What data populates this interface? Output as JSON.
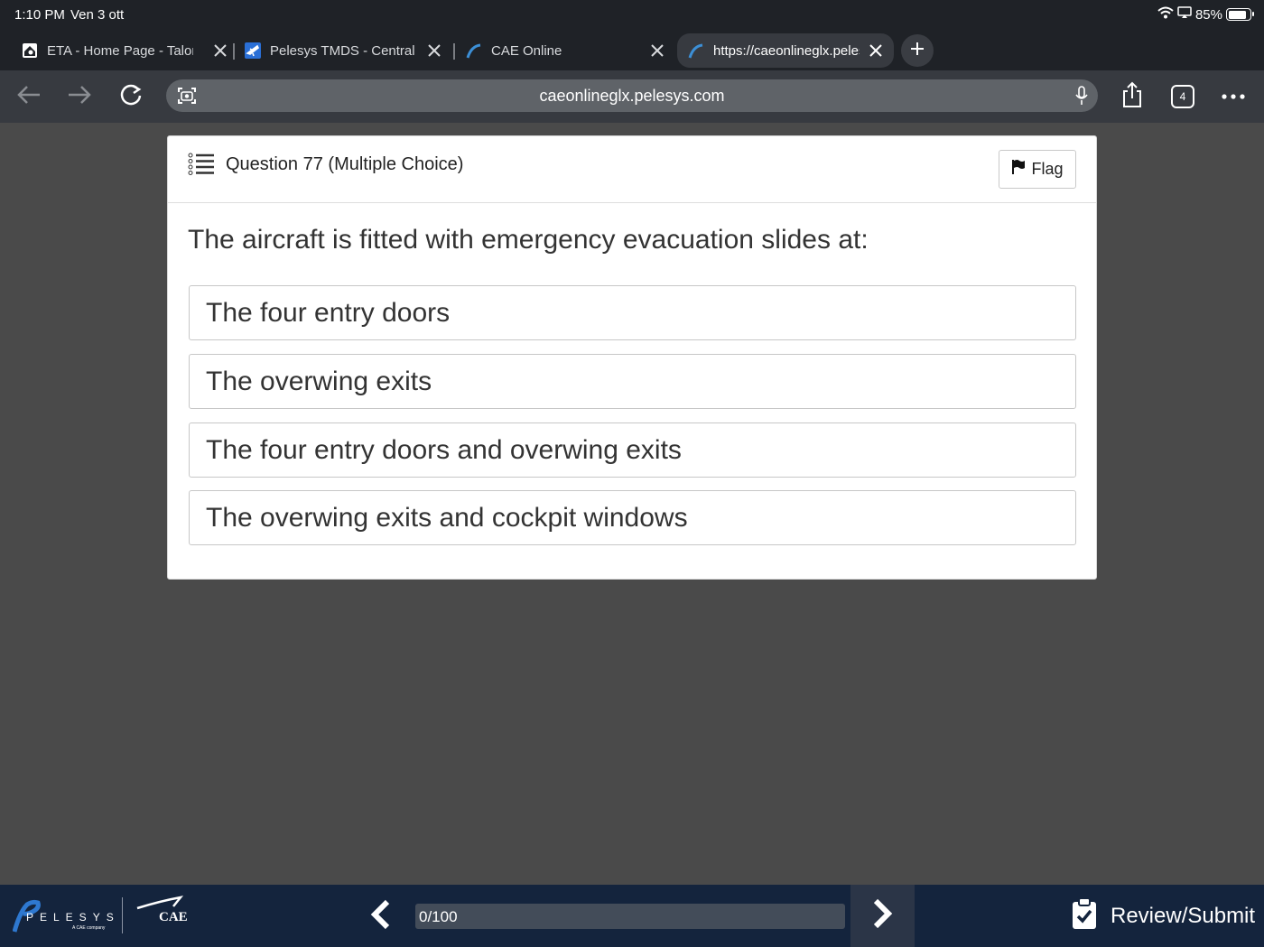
{
  "status": {
    "time": "1:10 PM",
    "date": "Ven 3 ott",
    "battery": "85%",
    "battery_level": 0.85
  },
  "tabs": [
    {
      "title": "ETA - Home Page - Talon",
      "icon": "home-icon"
    },
    {
      "title": "Pelesys TMDS - Central",
      "icon": "airplane-icon"
    },
    {
      "title": "CAE Online",
      "icon": "pelesys-icon"
    },
    {
      "title": "https://caeonlineglx.pelesys.com",
      "icon": "pelesys-icon",
      "active": true
    }
  ],
  "toolbar": {
    "url": "caeonlineglx.pelesys.com",
    "tab_count": "4"
  },
  "question": {
    "header": "Question 77 (Multiple Choice)",
    "flag_label": "Flag",
    "text": "The aircraft is fitted with emergency evacuation slides at:",
    "options": [
      "The four entry doors",
      "The overwing exits",
      "The four entry doors and overwing exits",
      "The overwing exits and cockpit windows"
    ]
  },
  "footer": {
    "pelesys_logo": "PELESYS",
    "pelesys_sub": "A CAE company",
    "cae_logo": "CAE",
    "progress_text": "0/100",
    "progress_value": 0,
    "review_label": "Review/Submit"
  },
  "colors": {
    "accent": "#5ea0d8",
    "footer_bg": "#14243d",
    "page_bg": "#4a4a4a"
  }
}
